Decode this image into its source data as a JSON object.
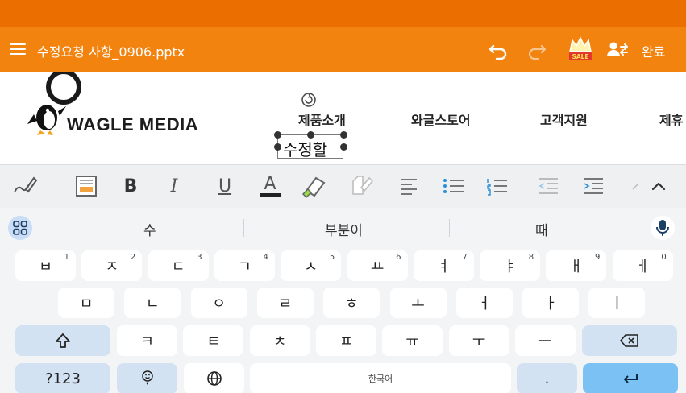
{
  "app": {
    "file_title": "수정요청 사항_0906.pptx",
    "done_label": "완료",
    "sale_badge": "SALE"
  },
  "document": {
    "logo_text": "WAGLE MEDIA",
    "nav": [
      "제품소개",
      "와글스토어",
      "고객지원",
      "제휴"
    ],
    "editing_text": "수정할"
  },
  "toolbar": {
    "bold": "B",
    "italic": "I",
    "underline": "U",
    "font_color": "A"
  },
  "suggestions": [
    "수",
    "부분이",
    "때"
  ],
  "keyboard": {
    "row1": [
      {
        "k": "ㅂ",
        "n": "1"
      },
      {
        "k": "ㅈ",
        "n": "2"
      },
      {
        "k": "ㄷ",
        "n": "3"
      },
      {
        "k": "ㄱ",
        "n": "4"
      },
      {
        "k": "ㅅ",
        "n": "5"
      },
      {
        "k": "ㅛ",
        "n": "6"
      },
      {
        "k": "ㅕ",
        "n": "7"
      },
      {
        "k": "ㅑ",
        "n": "8"
      },
      {
        "k": "ㅐ",
        "n": "9"
      },
      {
        "k": "ㅔ",
        "n": "0"
      }
    ],
    "row2": [
      "ㅁ",
      "ㄴ",
      "ㅇ",
      "ㄹ",
      "ㅎ",
      "ㅗ",
      "ㅓ",
      "ㅏ",
      "ㅣ"
    ],
    "row3": [
      "ㅋ",
      "ㅌ",
      "ㅊ",
      "ㅍ",
      "ㅠ",
      "ㅜ",
      "ㅡ"
    ],
    "symbols_label": "?123",
    "space_label": "한국어",
    "period_label": "."
  },
  "colors": {
    "status_bar": "#ea6f00",
    "app_bar": "#f2830f",
    "enter_key": "#7cc1f4",
    "modifier_key": "#d3e2f3"
  }
}
